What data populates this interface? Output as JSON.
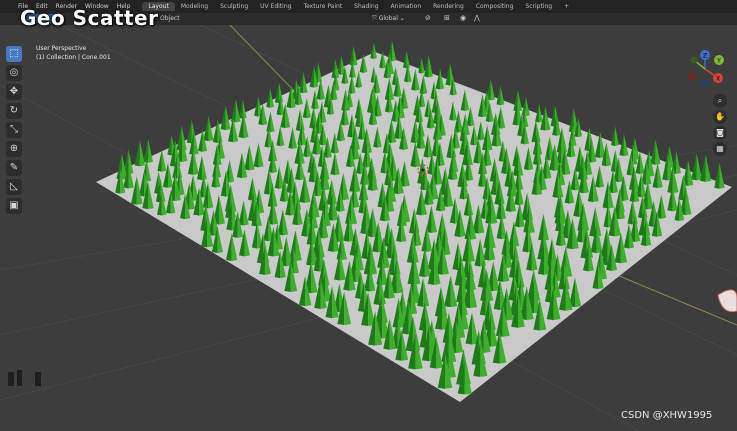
{
  "overlay_title": "Geo Scatter",
  "menu": [
    "File",
    "Edit",
    "Render",
    "Window",
    "Help"
  ],
  "workspace_tabs": [
    {
      "label": "Layout",
      "active": true
    },
    {
      "label": "Modeling",
      "active": false
    },
    {
      "label": "Sculpting",
      "active": false
    },
    {
      "label": "UV Editing",
      "active": false
    },
    {
      "label": "Texture Paint",
      "active": false
    },
    {
      "label": "Shading",
      "active": false
    },
    {
      "label": "Animation",
      "active": false
    },
    {
      "label": "Rendering",
      "active": false
    },
    {
      "label": "Compositing",
      "active": false
    },
    {
      "label": "Scripting",
      "active": false
    }
  ],
  "add_tab_label": "+",
  "header": {
    "object_menu": "Object",
    "transform_orientation": "Global"
  },
  "viewport": {
    "view_name": "User Perspective",
    "collection_info": "(1) Collection | Cone.001"
  },
  "tools": [
    "select-box",
    "cursor",
    "move",
    "rotate",
    "scale",
    "transform",
    "annotate",
    "measure",
    "add-cube"
  ],
  "nav_gizmo": {
    "x": "X",
    "y": "Y",
    "z": "Z"
  },
  "colors": {
    "accent": "#4a78c2",
    "ground": "#c8c8c8",
    "tree_dark": "#1f7a1a",
    "tree_light": "#3fae2f",
    "axis_x": "#d8433e",
    "axis_y": "#7fb43a",
    "axis_z": "#3b72c9"
  },
  "watermark": "CSDN @XHW1995"
}
